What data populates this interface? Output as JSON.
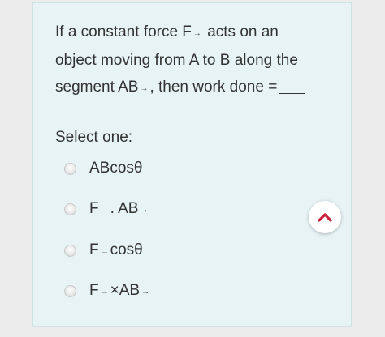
{
  "question": {
    "line1_a": "If a constant force F",
    "line1_b": "acts on an",
    "line2": "object moving from A to B along the",
    "line3_a": "segment AB",
    "line3_b": ", then work done ="
  },
  "vector_arrow": "→",
  "select_label": "Select one:",
  "options": [
    {
      "parts": [
        "ABcosθ"
      ]
    },
    {
      "parts": [
        "F",
        ". AB",
        ""
      ]
    },
    {
      "parts": [
        "F",
        "cosθ"
      ]
    },
    {
      "parts": [
        "F",
        "×AB",
        ""
      ]
    }
  ],
  "nav_icon": "chevron-up-icon",
  "colors": {
    "card_background": "#e7f3f5",
    "nav_arrow": "#cc1f3a"
  }
}
